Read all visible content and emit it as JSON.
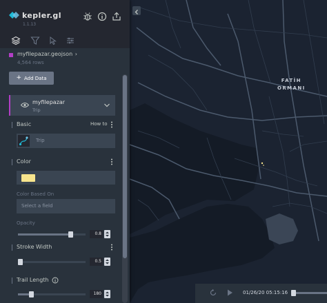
{
  "app": {
    "name": "kepler.gl",
    "version": "1.1.13"
  },
  "dataset": {
    "name": "myfilepazar.geojson",
    "rows": "4,564 rows",
    "color": "#b23fc6"
  },
  "add_data_label": "Add Data",
  "layer": {
    "name": "myfilepazar",
    "type": "Trip",
    "basic": {
      "title": "Basic",
      "how_to": "How to"
    },
    "color": {
      "title": "Color",
      "swatch": "#f8e58d"
    },
    "color_based_on": {
      "label": "Color Based On",
      "placeholder": "Select a field"
    },
    "opacity": {
      "label": "Opacity",
      "value": "0.8",
      "fraction": 0.8
    },
    "stroke_width": {
      "title": "Stroke Width",
      "value": "0.5",
      "fraction": 0.0
    },
    "trail_length": {
      "title": "Trail Length",
      "value": "180",
      "fraction": 0.18
    }
  },
  "map": {
    "labels": {
      "district": "FATİH",
      "area": "ORMANI"
    }
  },
  "timebar": {
    "time": "01/26/20 05:15:16",
    "fraction": 0.0
  },
  "colors": {
    "accent": "#1fbad6",
    "panel": "#29323c",
    "header": "#242730",
    "map": "#1b2331"
  }
}
